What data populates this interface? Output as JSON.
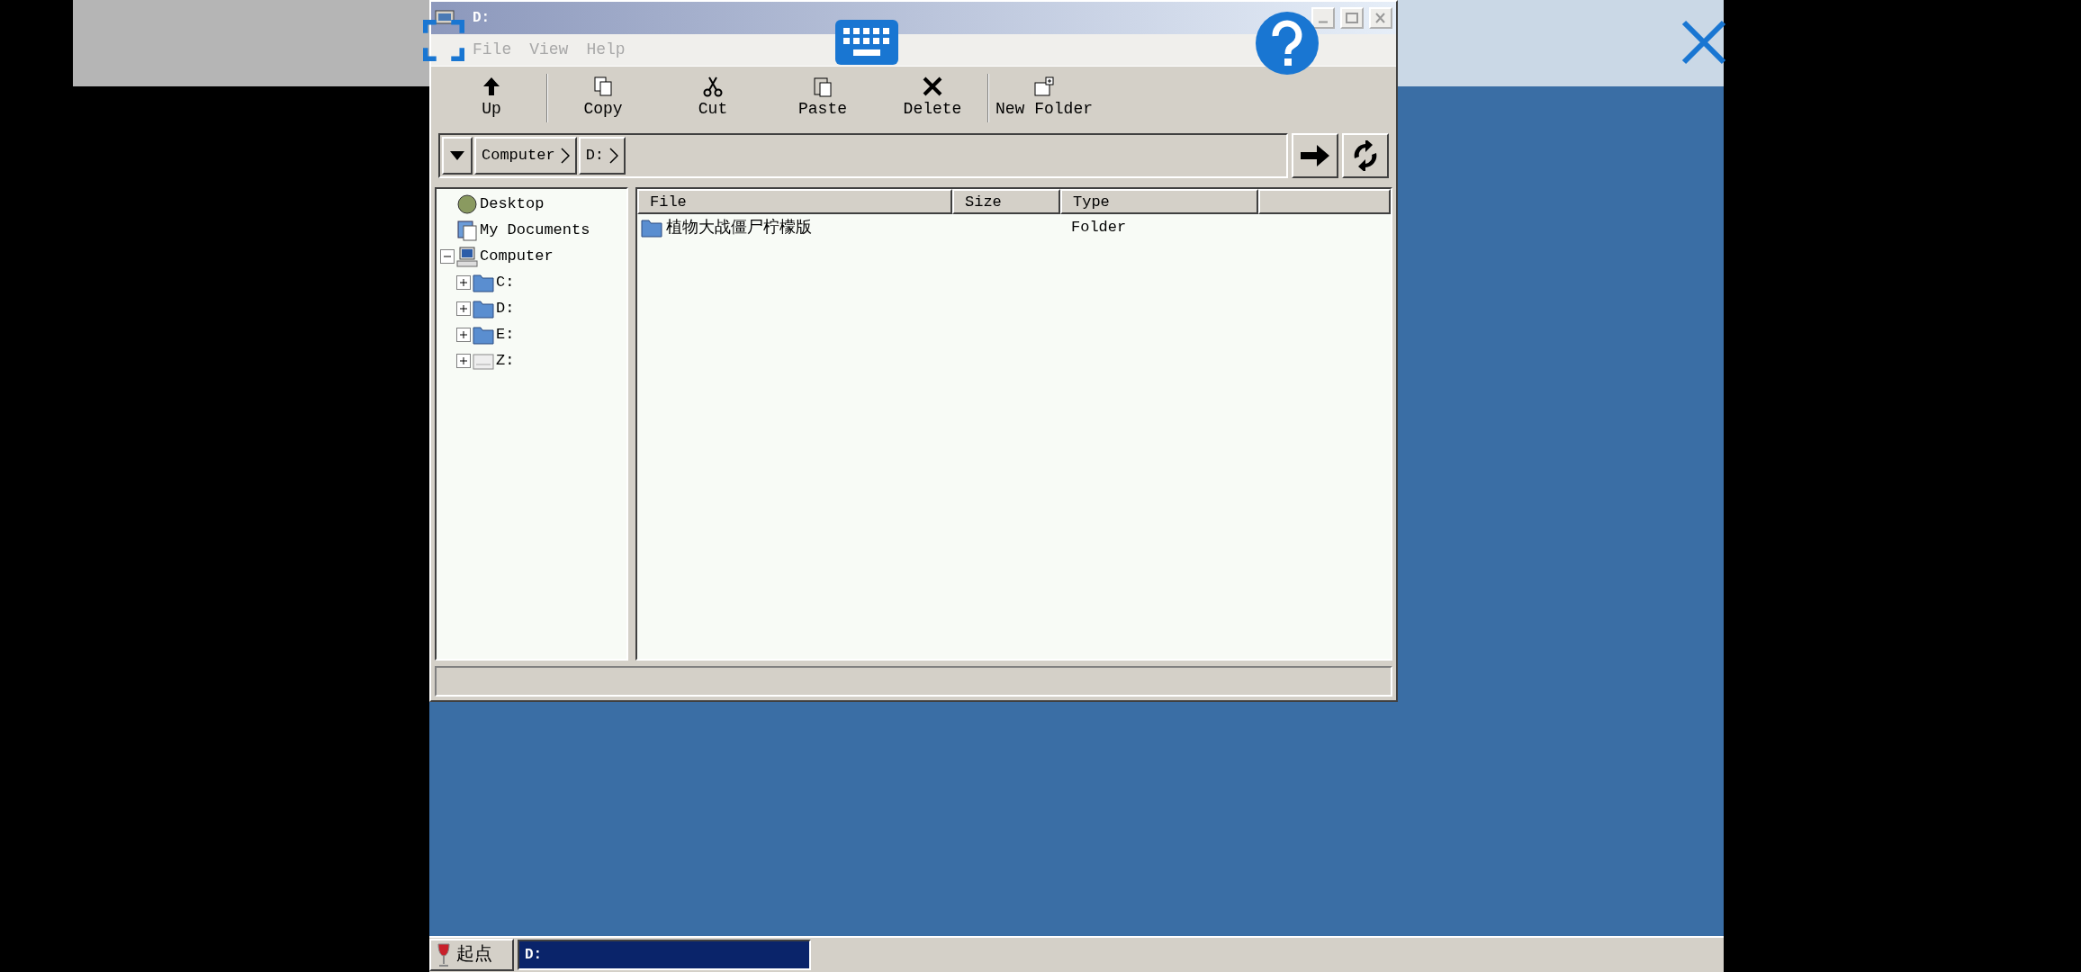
{
  "window": {
    "title": "D:"
  },
  "menu": [
    "File",
    "View",
    "Help"
  ],
  "toolbar": [
    {
      "kind": "up",
      "label": "Up"
    },
    {
      "kind": "copy",
      "label": "Copy"
    },
    {
      "kind": "cut",
      "label": "Cut"
    },
    {
      "kind": "paste",
      "label": "Paste"
    },
    {
      "kind": "delete",
      "label": "Delete"
    },
    {
      "kind": "newfolder",
      "label": "New Folder"
    }
  ],
  "address": {
    "crumbs": [
      "Computer",
      "D:"
    ]
  },
  "tree": [
    {
      "label": "Desktop",
      "kind": "desktop"
    },
    {
      "label": "My Documents",
      "kind": "documents"
    },
    {
      "label": "Computer",
      "kind": "computer",
      "expanded": true,
      "children": [
        {
          "label": "C:",
          "kind": "drive",
          "expanded": false
        },
        {
          "label": "D:",
          "kind": "drive",
          "expanded": false
        },
        {
          "label": "E:",
          "kind": "drive",
          "expanded": false
        },
        {
          "label": "Z:",
          "kind": "network",
          "expanded": false
        }
      ]
    }
  ],
  "file_list": {
    "columns": [
      "File",
      "Size",
      "Type"
    ],
    "rows": [
      {
        "name": "植物大战僵尸柠檬版",
        "type": "Folder"
      }
    ]
  },
  "taskbar": {
    "start": "起点",
    "tasks": [
      {
        "label": "D:",
        "selected": true
      }
    ]
  }
}
